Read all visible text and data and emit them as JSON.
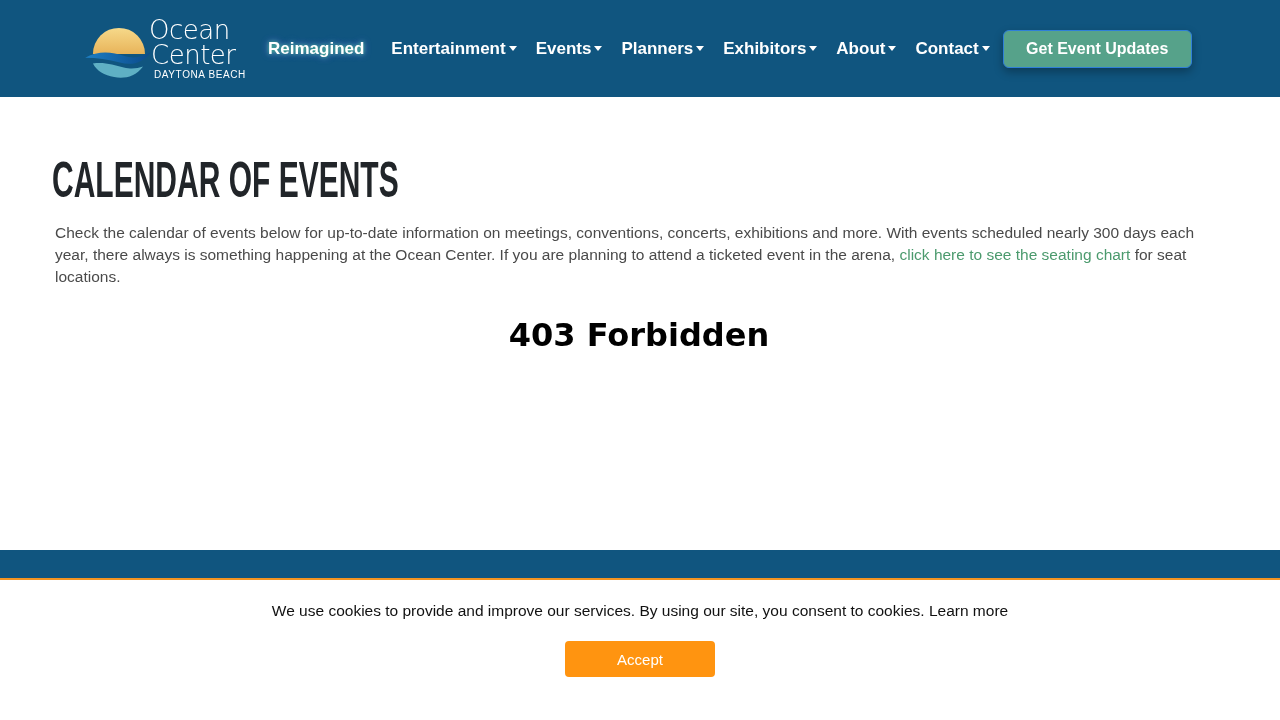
{
  "header": {
    "logo": {
      "line_1": "Ocean",
      "line_2": "Center",
      "tagline": "DAYTONA BEACH"
    },
    "nav": [
      {
        "label": "Reimagined",
        "kind": "glow"
      },
      {
        "label": "Entertainment",
        "kind": "dropdown"
      },
      {
        "label": "Events",
        "kind": "dropdown"
      },
      {
        "label": "Planners",
        "kind": "dropdown"
      },
      {
        "label": "Exhibitors",
        "kind": "dropdown"
      },
      {
        "label": "About",
        "kind": "dropdown"
      },
      {
        "label": "Contact",
        "kind": "dropdown"
      }
    ],
    "cta_button": "Get Event Updates"
  },
  "main": {
    "title": "CALENDAR OF EVENTS",
    "intro": {
      "text_before": "Check the calendar of events below for up-to-date information on meetings, conventions, concerts, exhibitions and more. With events scheduled nearly 300 days each year, there always is something happening at the Ocean Center. If you are planning to attend a ticketed event in the arena,",
      "link": "click here to see the seating chart",
      "text_after": "for seat locations."
    },
    "error_message": "403 Forbidden"
  },
  "cookie_banner": {
    "text": "We use cookies to provide and improve our services. By using our site, you consent to cookies.",
    "link": "Learn more",
    "button": "Accept"
  }
}
